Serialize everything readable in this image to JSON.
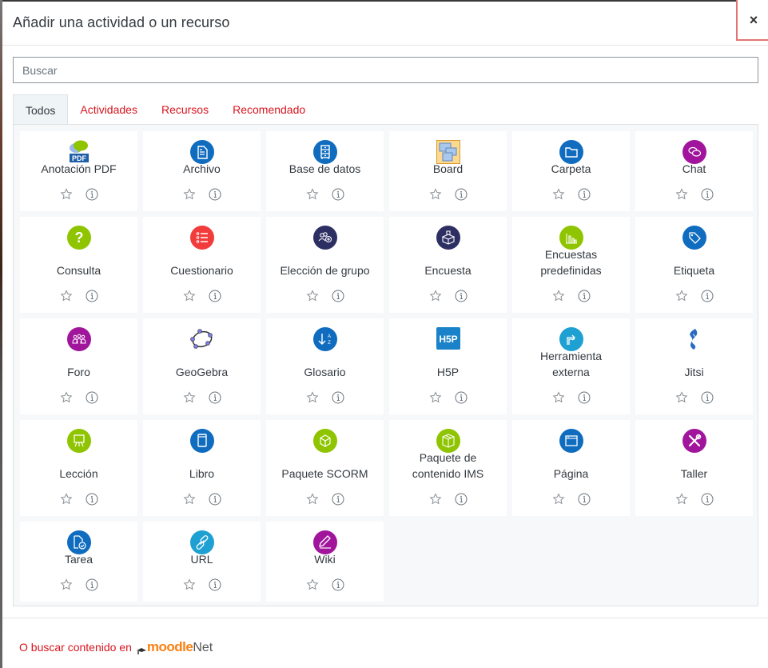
{
  "modal": {
    "title": "Añadir una actividad o un recurso",
    "close_label": "×"
  },
  "search": {
    "placeholder": "Buscar",
    "value": ""
  },
  "tabs": [
    {
      "label": "Todos",
      "active": true
    },
    {
      "label": "Actividades",
      "active": false
    },
    {
      "label": "Recursos",
      "active": false
    },
    {
      "label": "Recomendado",
      "active": false
    }
  ],
  "items": [
    {
      "label": "Anotación PDF",
      "icon": "pdf-annotation-icon",
      "color": "#8bbf00"
    },
    {
      "label": "Archivo",
      "icon": "file-icon",
      "color": "#0f6cbf"
    },
    {
      "label": "Base de datos",
      "icon": "database-icon",
      "color": "#0f6cbf"
    },
    {
      "label": "Board",
      "icon": "board-icon",
      "color": "#f5b942"
    },
    {
      "label": "Carpeta",
      "icon": "folder-icon",
      "color": "#0f6cbf"
    },
    {
      "label": "Chat",
      "icon": "chat-icon",
      "color": "#a0159b"
    },
    {
      "label": "Consulta",
      "icon": "question-icon",
      "color": "#8fc400"
    },
    {
      "label": "Cuestionario",
      "icon": "quiz-list-icon",
      "color": "#f23c3c"
    },
    {
      "label": "Elección de grupo",
      "icon": "group-choice-icon",
      "color": "#2d2f63"
    },
    {
      "label": "Encuesta",
      "icon": "ballot-box-icon",
      "color": "#2d2f63"
    },
    {
      "label": "Encuestas predefinidas",
      "icon": "bar-chart-icon",
      "color": "#8fc400"
    },
    {
      "label": "Etiqueta",
      "icon": "tag-icon",
      "color": "#0f6cbf"
    },
    {
      "label": "Foro",
      "icon": "forum-users-icon",
      "color": "#a0159b"
    },
    {
      "label": "GeoGebra",
      "icon": "geogebra-icon",
      "color": "#7b7de8"
    },
    {
      "label": "Glosario",
      "icon": "sort-az-icon",
      "color": "#0f6cbf"
    },
    {
      "label": "H5P",
      "icon": "h5p-icon",
      "color": "#1a82c8"
    },
    {
      "label": "Herramienta externa",
      "icon": "external-tool-icon",
      "color": "#1fa0d2"
    },
    {
      "label": "Jitsi",
      "icon": "jitsi-icon",
      "color": "#2a6bbf"
    },
    {
      "label": "Lección",
      "icon": "easel-icon",
      "color": "#8fc400"
    },
    {
      "label": "Libro",
      "icon": "book-icon",
      "color": "#0f6cbf"
    },
    {
      "label": "Paquete SCORM",
      "icon": "scorm-package-icon",
      "color": "#8fc400"
    },
    {
      "label": "Paquete de contenido IMS",
      "icon": "ims-package-icon",
      "color": "#8fc400"
    },
    {
      "label": "Página",
      "icon": "page-icon",
      "color": "#0f6cbf"
    },
    {
      "label": "Taller",
      "icon": "workshop-tools-icon",
      "color": "#a0159b"
    },
    {
      "label": "Tarea",
      "icon": "assignment-icon",
      "color": "#0f6cbf"
    },
    {
      "label": "URL",
      "icon": "link-icon",
      "color": "#1fa0d2"
    },
    {
      "label": "Wiki",
      "icon": "wiki-pencil-icon",
      "color": "#a0159b"
    }
  ],
  "footer": {
    "link_text": "O buscar contenido en",
    "logo_moodle": "moodle",
    "logo_net": "Net"
  }
}
